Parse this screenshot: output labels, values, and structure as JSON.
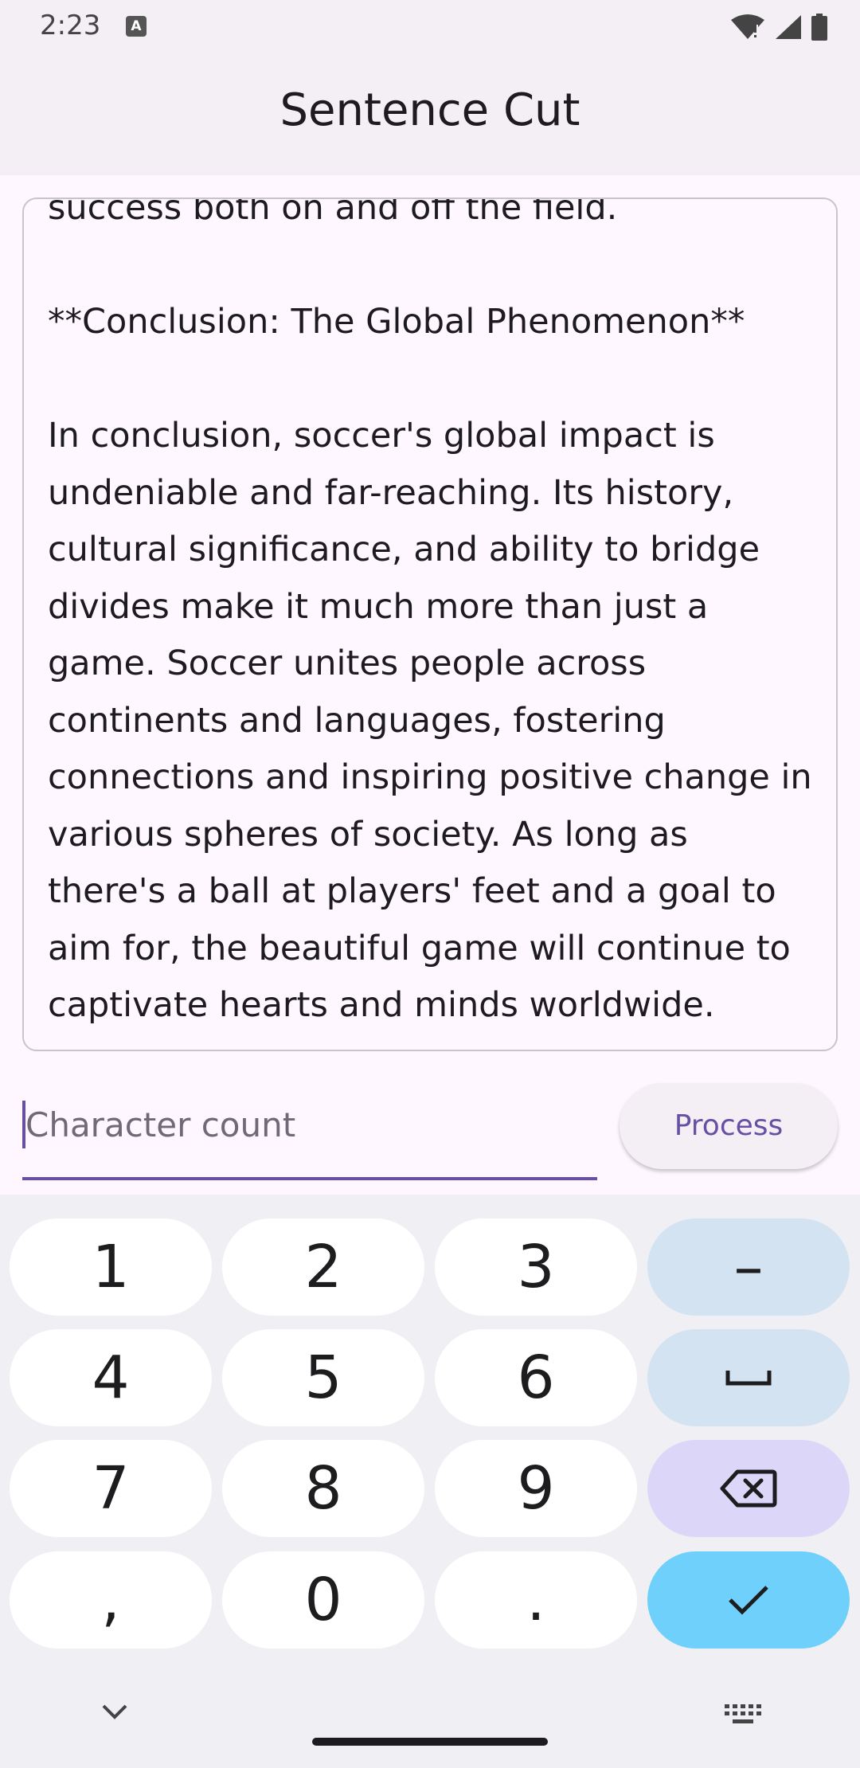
{
  "status_bar": {
    "time": "2:23",
    "notification_icon": "text-a-icon",
    "icons": [
      "wifi-alert-icon",
      "signal-icon",
      "battery-icon"
    ]
  },
  "app_bar": {
    "title": "Sentence Cut"
  },
  "text_area": {
    "value": "success both on and off the field.\n\n**Conclusion: The Global Phenomenon**\n\nIn conclusion, soccer's global impact is undeniable and far-reaching. Its history, cultural significance, and ability to bridge divides make it much more than just a game. Soccer unites people across continents and languages, fostering connections and inspiring positive change in various spheres of society. As long as there's a ball at players' feet and a goal to aim for, the beautiful game will continue to captivate hearts and minds worldwide."
  },
  "char_input": {
    "placeholder": "Character count",
    "value": ""
  },
  "process_button": {
    "label": "Process"
  },
  "keyboard": {
    "keys": {
      "k1": "1",
      "k2": "2",
      "k3": "3",
      "dash": "–",
      "k4": "4",
      "k5": "5",
      "k6": "6",
      "k7": "7",
      "k8": "8",
      "k9": "9",
      "comma": ",",
      "k0": "0",
      "period": "."
    },
    "icons": [
      "space-icon",
      "backspace-icon",
      "checkmark-icon",
      "chevron-down-icon",
      "keyboard-icon"
    ]
  },
  "colors": {
    "accent": "#6750a4",
    "enter_key": "#6fd0fb",
    "function_key": "#d3e3f1",
    "backspace_key": "#dcd7f8"
  }
}
